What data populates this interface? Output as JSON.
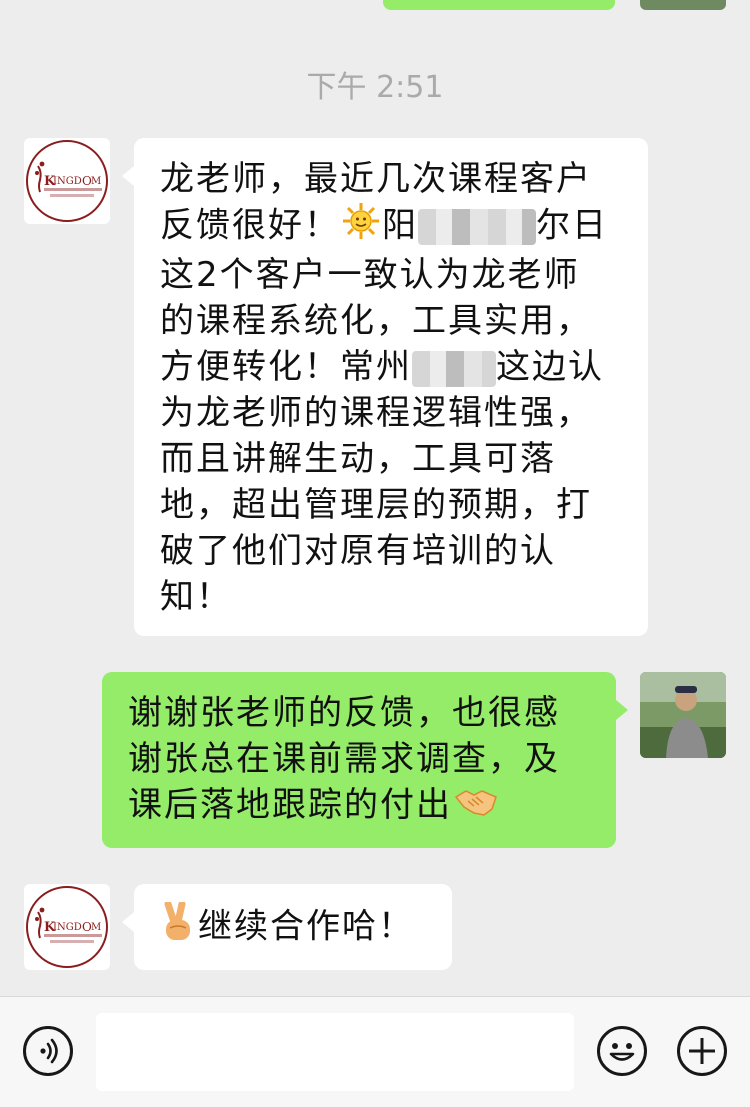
{
  "timestamp": "下午 2:51",
  "messages": {
    "m1": {
      "line1": "龙老师，最近几次课程客户",
      "line2_a": "反馈很好！",
      "line2_b": "阳",
      "line2_c": "尔日",
      "line3": "这2个客户一致认为龙老师",
      "line4": "的课程系统化，工具实用，",
      "line5_a": "方便转化！常州",
      "line5_b": "这边认",
      "line6": "为龙老师的课程逻辑性强，",
      "line7": "而且讲解生动，工具可落",
      "line8": "地，超出管理层的预期，打",
      "line9": "破了他们对原有培训的认",
      "line10": "知！"
    },
    "m2": {
      "line1": "谢谢张老师的反馈，也很感",
      "line2": "谢张总在课前需求调查，及",
      "line3": "课后落地跟踪的付出"
    },
    "m3": {
      "text": "继续合作哈！"
    }
  },
  "avatar_logo": {
    "brand": "KINGDOM",
    "subtitle": "无锡凯德管理顾问有限公司"
  },
  "icons": {
    "voice": "voice-icon",
    "emoji": "emoji-icon",
    "more": "plus-icon",
    "sun": "sun-emoji-icon",
    "handshake": "handshake-emoji-icon",
    "victory": "victory-hand-emoji-icon"
  },
  "colors": {
    "background": "#ededed",
    "bubble_self": "#95ec69",
    "bubble_other": "#ffffff",
    "timestamp": "#aaaaaa"
  }
}
